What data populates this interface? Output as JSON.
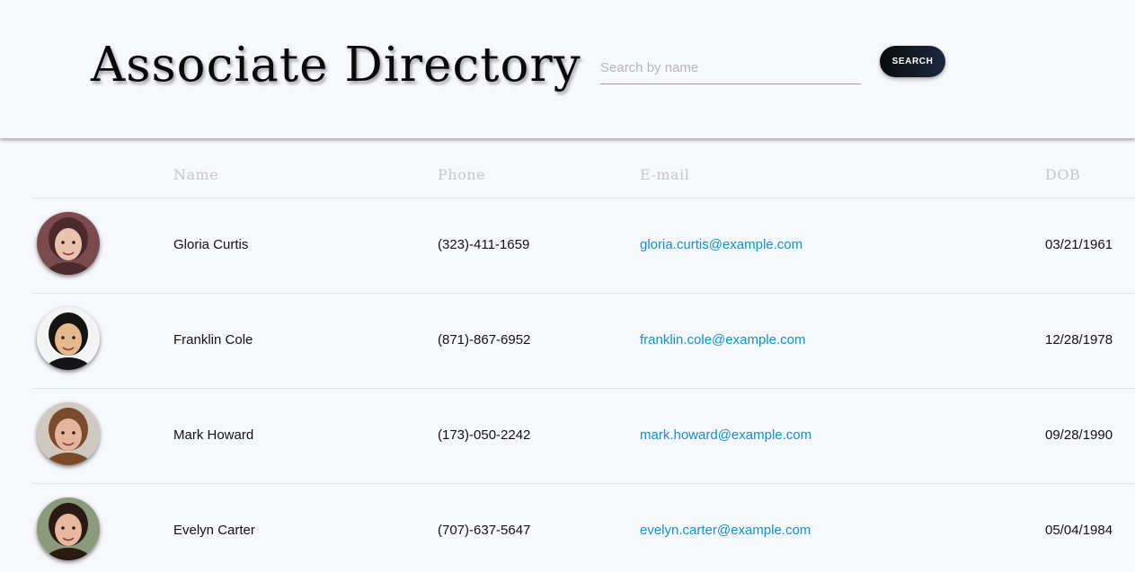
{
  "header": {
    "title": "Associate Directory",
    "search_placeholder": "Search by name",
    "search_value": "",
    "search_button_label": "SEARCH"
  },
  "table": {
    "columns": [
      "",
      "Name",
      "Phone",
      "E-mail",
      "DOB"
    ],
    "rows": [
      {
        "name": "Gloria Curtis",
        "phone": "(323)-411-1659",
        "email": "gloria.curtis@example.com",
        "dob": "03/21/1961",
        "avatar": {
          "bg": "#7a4a4e",
          "skin": "#e8c4b0",
          "hair": "#4a2a2c"
        }
      },
      {
        "name": "Franklin Cole",
        "phone": "(871)-867-6952",
        "email": "franklin.cole@example.com",
        "dob": "12/28/1978",
        "avatar": {
          "bg": "#f4f4f4",
          "skin": "#e5b98e",
          "hair": "#141414"
        }
      },
      {
        "name": "Mark Howard",
        "phone": "(173)-050-2242",
        "email": "mark.howard@example.com",
        "dob": "09/28/1990",
        "avatar": {
          "bg": "#cfc9c1",
          "skin": "#e4b49c",
          "hair": "#7a4a2a"
        }
      },
      {
        "name": "Evelyn Carter",
        "phone": "(707)-637-5647",
        "email": "evelyn.carter@example.com",
        "dob": "05/04/1984",
        "avatar": {
          "bg": "#8a9a7a",
          "skin": "#e8b8a0",
          "hair": "#2a1a12"
        }
      }
    ]
  },
  "colors": {
    "accent_link": "#1590c8",
    "button_start": "#0b0b0b",
    "button_end": "#1d2940",
    "background": "#f7f8fc"
  }
}
